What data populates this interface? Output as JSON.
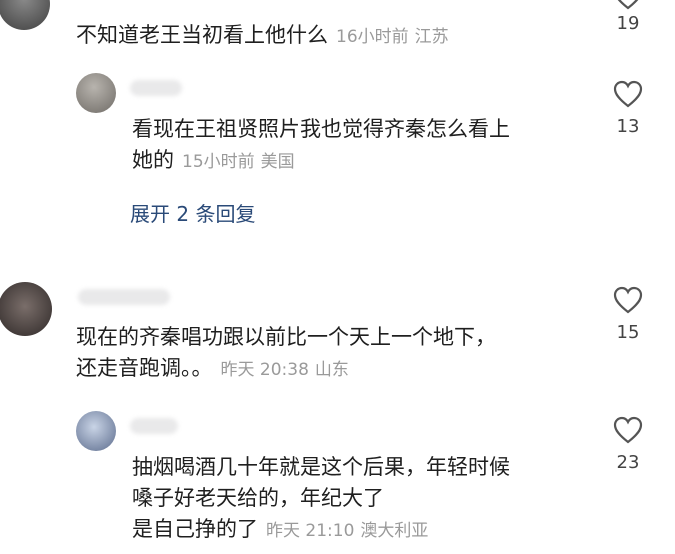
{
  "comments": [
    {
      "text_lines": [
        "不知道老王当初看上他什么"
      ],
      "time": "16小时前",
      "location": "江苏",
      "likes": "19"
    },
    {
      "text_lines": [
        "看现在王祖贤照片我也觉得齐秦怎么看上",
        "她的"
      ],
      "time": "15小时前",
      "location": "美国",
      "likes": "13",
      "expand_label": "展开 2 条回复"
    },
    {
      "text_lines": [
        "现在的齐秦唱功跟以前比一个天上一个地下，",
        "还走音跑调。。"
      ],
      "time": "昨天 20:38",
      "location": "山东",
      "likes": "15"
    },
    {
      "text_lines": [
        "抽烟喝酒几十年就是这个后果，年轻时候",
        "嗓子好老天给的，年纪大了",
        "是自己挣的了"
      ],
      "time": "昨天 21:10",
      "location": "澳大利亚",
      "likes": "23"
    }
  ],
  "icons": {
    "like": "heart-outline-icon"
  },
  "colors": {
    "text": "#1f1f1f",
    "meta": "#9a9a9a",
    "link": "#2a4a78"
  }
}
